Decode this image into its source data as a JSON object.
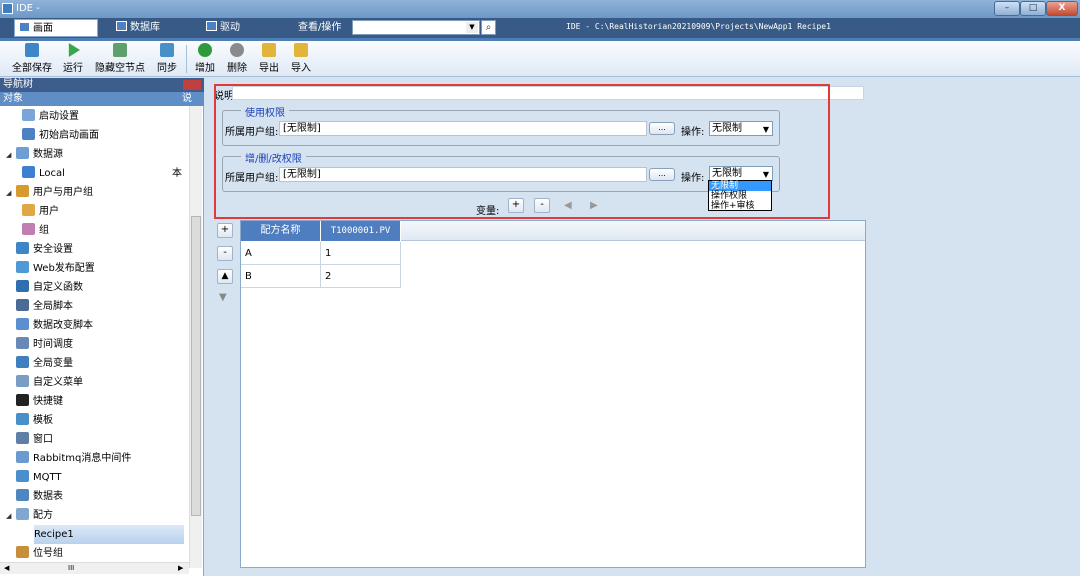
{
  "window": {
    "title": "IDE -",
    "path": "IDE - C:\\RealHistorian20210909\\Projects\\NewApp1  Recipe1",
    "min": "–",
    "max": "□",
    "close": "X"
  },
  "menu": {
    "tabs": [
      "画面",
      "数据库",
      "驱动",
      "查看/操作"
    ],
    "combo_value": ""
  },
  "toolbar": {
    "items": [
      "全部保存",
      "运行",
      "隐藏空节点",
      "同步",
      "增加",
      "删除",
      "导出",
      "导入"
    ]
  },
  "nav": {
    "title": "导航树",
    "col1": "对象",
    "col2": "说",
    "items": [
      {
        "label": "启动设置",
        "level": 2
      },
      {
        "label": "初始启动画面",
        "level": 2
      },
      {
        "label": "数据源",
        "level": 1,
        "expand": "◢"
      },
      {
        "label": "Local",
        "level": 2,
        "extra": "本"
      },
      {
        "label": "用户与用户组",
        "level": 1,
        "expand": "◢"
      },
      {
        "label": "用户",
        "level": 2
      },
      {
        "label": "组",
        "level": 2
      },
      {
        "label": "安全设置",
        "level": 1
      },
      {
        "label": "Web发布配置",
        "level": 1
      },
      {
        "label": "自定义函数",
        "level": 1
      },
      {
        "label": "全局脚本",
        "level": 1
      },
      {
        "label": "数据改变脚本",
        "level": 1
      },
      {
        "label": "时间调度",
        "level": 1
      },
      {
        "label": "全局变量",
        "level": 1
      },
      {
        "label": "自定义菜单",
        "level": 1
      },
      {
        "label": "快捷键",
        "level": 1
      },
      {
        "label": "模板",
        "level": 1
      },
      {
        "label": "窗口",
        "level": 1
      },
      {
        "label": "Rabbitmq消息中间件",
        "level": 1
      },
      {
        "label": "MQTT",
        "level": 1
      },
      {
        "label": "数据表",
        "level": 1
      },
      {
        "label": "配方",
        "level": 1,
        "expand": "◢"
      },
      {
        "label": "Recipe1",
        "level": 2,
        "selected": true
      },
      {
        "label": "位号组",
        "level": 1
      }
    ],
    "hscroll_thumb": "III"
  },
  "main": {
    "desc_label": "说明:",
    "group1": {
      "title": "使用权限",
      "group_label": "所属用户组:",
      "group_value": "[无限制]",
      "dots": "...",
      "op_label": "操作:",
      "op_value": "无限制"
    },
    "group2": {
      "title": "增/删/改权限",
      "group_label": "所属用户组:",
      "group_value": "[无限制]",
      "dots": "...",
      "op_label": "操作:",
      "op_value": "无限制"
    },
    "dropdown_options": [
      "无限制",
      "操作权限",
      "操作+审核"
    ],
    "var_label": "变量:",
    "plus": "+",
    "minus": "-",
    "prev": "◀",
    "next": "▶",
    "side_plus": "+",
    "side_minus": "-",
    "side_up": "▲",
    "side_down": "▼"
  },
  "table": {
    "headers": [
      "配方名称",
      "T1000001.PV"
    ],
    "rows": [
      [
        "A",
        "1"
      ],
      [
        "B",
        "2"
      ]
    ]
  }
}
